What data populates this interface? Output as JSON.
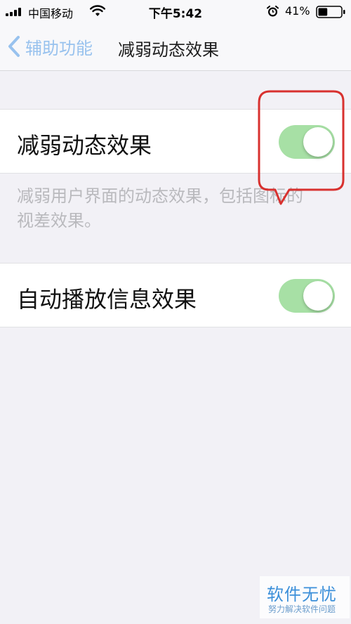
{
  "status_bar": {
    "carrier": "中国移动",
    "time": "下午5:42",
    "battery_percent": "41%",
    "battery_level": 0.41,
    "icons": [
      "signal-icon",
      "wifi-icon",
      "alarm-icon",
      "battery-icon"
    ]
  },
  "nav": {
    "back_label": "辅助功能",
    "title": "减弱动态效果",
    "back_color": "#98c2ee"
  },
  "settings": [
    {
      "label": "减弱动态效果",
      "enabled": true
    },
    {
      "label": "自动播放信息效果",
      "enabled": true
    }
  ],
  "footer": "减弱用户界面的动态效果，包括图标的视差效果。",
  "colors": {
    "toggle_on": "#a7e0a5",
    "annotation": "#d8312f",
    "background": "#f2f1f6"
  },
  "watermark": {
    "main": "软件无忧",
    "sub": "努力解决软件问题"
  }
}
